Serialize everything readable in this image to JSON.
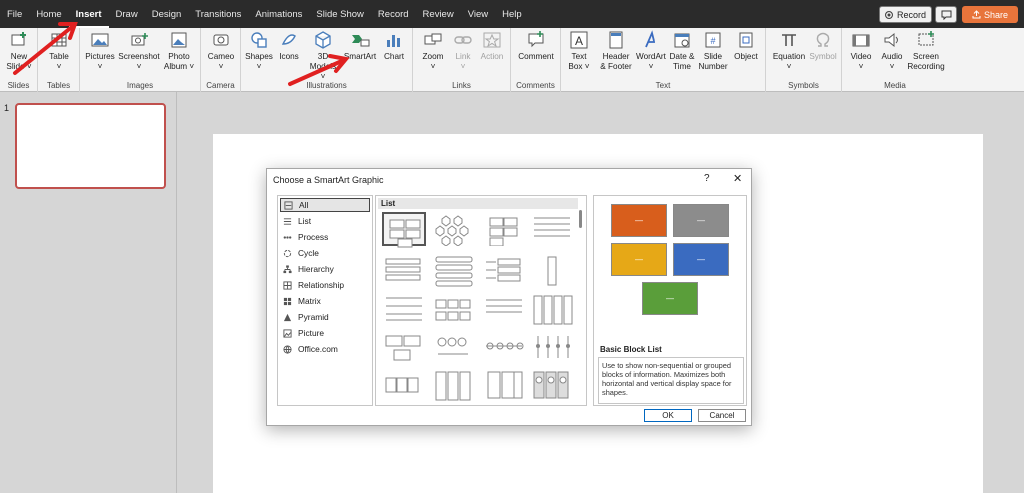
{
  "menubar": {
    "tabs": [
      "File",
      "Home",
      "Insert",
      "Draw",
      "Design",
      "Transitions",
      "Animations",
      "Slide Show",
      "Record",
      "Review",
      "View",
      "Help"
    ],
    "active_tab": "Insert",
    "record_label": "Record",
    "share_label": "Share"
  },
  "ribbon": {
    "groups": {
      "slides": "Slides",
      "tables": "Tables",
      "images": "Images",
      "camera": "Camera",
      "illustrations": "Illustrations",
      "links": "Links",
      "comments": "Comments",
      "text": "Text",
      "symbols": "Symbols",
      "media": "Media"
    },
    "buttons": {
      "new_slide_1": "New",
      "new_slide_2": "Slide",
      "table": "Table",
      "pictures": "Pictures",
      "screenshot": "Screenshot",
      "photo_album_1": "Photo",
      "photo_album_2": "Album",
      "cameo": "Cameo",
      "shapes": "Shapes",
      "icons": "Icons",
      "models_1": "3D",
      "models_2": "Models",
      "smartart": "SmartArt",
      "chart": "Chart",
      "zoom": "Zoom",
      "link": "Link",
      "action": "Action",
      "comment": "Comment",
      "textbox_1": "Text",
      "textbox_2": "Box",
      "header_1": "Header",
      "header_2": "& Footer",
      "wordart": "WordArt",
      "datetime_1": "Date &",
      "datetime_2": "Time",
      "slidenum_1": "Slide",
      "slidenum_2": "Number",
      "object": "Object",
      "equation": "Equation",
      "symbol": "Symbol",
      "video": "Video",
      "audio": "Audio",
      "screenrec_1": "Screen",
      "screenrec_2": "Recording"
    }
  },
  "thumbnails": {
    "slide_number": "1"
  },
  "dialog": {
    "title": "Choose a SmartArt Graphic",
    "help": "?",
    "close": "✕",
    "categories": [
      "All",
      "List",
      "Process",
      "Cycle",
      "Hierarchy",
      "Relationship",
      "Matrix",
      "Pyramid",
      "Picture",
      "Office.com"
    ],
    "selected_category": "All",
    "grid_header": "List",
    "preview": {
      "name": "Basic Block List",
      "description": "Use to show non-sequential or grouped blocks of information. Maximizes both horizontal and vertical display space for shapes.",
      "block_colors": [
        "#d85e1c",
        "#8c8c8c",
        "#e6a817",
        "#3a6bc0",
        "#5a9e3a"
      ]
    },
    "ok_label": "OK",
    "cancel_label": "Cancel"
  },
  "annotations": {
    "arrow_color": "#e02020"
  }
}
